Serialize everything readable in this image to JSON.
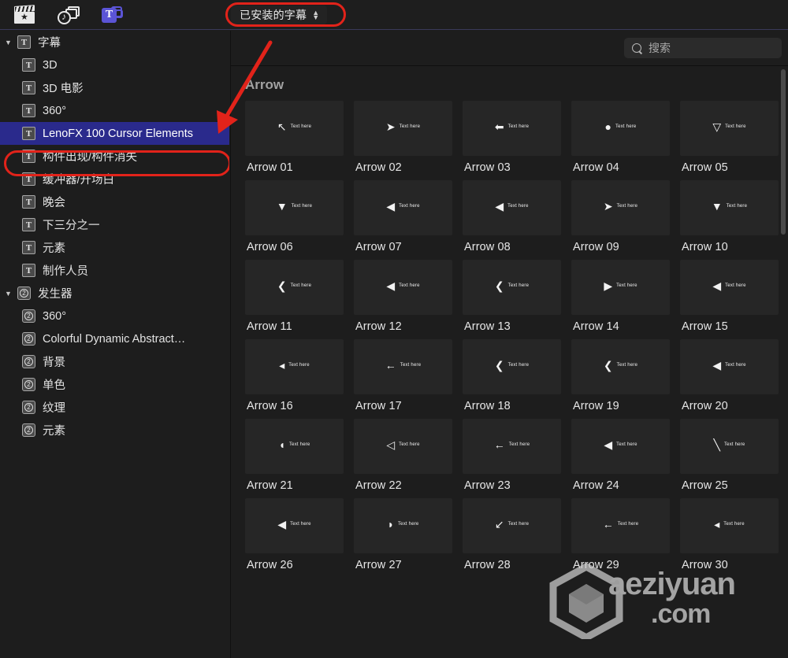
{
  "toolbar": {
    "icons": [
      {
        "name": "effects-clapperboard-icon",
        "label": "效果",
        "active": false
      },
      {
        "name": "music-photos-icon",
        "label": "音乐和照片",
        "active": false
      },
      {
        "name": "titles-generators-icon",
        "label": "T",
        "active": true
      }
    ],
    "popup": {
      "label": "已安装的字幕",
      "chevron": "⌃⌄"
    }
  },
  "annotations": {
    "oval_color": "#e2231a",
    "arrow_color": "#e2231a"
  },
  "sidebar": {
    "groups": [
      {
        "name": "titles",
        "label": "字幕",
        "icon": "title-badge-icon",
        "expanded": true,
        "twisty": "▼",
        "items": [
          {
            "label": "3D",
            "selected": false
          },
          {
            "label": "3D 电影",
            "selected": false
          },
          {
            "label": "360°",
            "selected": false
          },
          {
            "label": "LenoFX 100 Cursor Elements",
            "selected": true
          },
          {
            "label": "构件出现/构件消失",
            "selected": false
          },
          {
            "label": "缓冲器/开场白",
            "selected": false
          },
          {
            "label": "晚会",
            "selected": false
          },
          {
            "label": "下三分之一",
            "selected": false
          },
          {
            "label": "元素",
            "selected": false
          },
          {
            "label": "制作人员",
            "selected": false
          }
        ]
      },
      {
        "name": "generators",
        "label": "发生器",
        "icon": "generator-badge-icon",
        "expanded": true,
        "twisty": "▼",
        "items": [
          {
            "label": "360°",
            "selected": false
          },
          {
            "label": "Colorful Dynamic Abstract…",
            "selected": false
          },
          {
            "label": "背景",
            "selected": false
          },
          {
            "label": "单色",
            "selected": false
          },
          {
            "label": "纹理",
            "selected": false
          },
          {
            "label": "元素",
            "selected": false
          }
        ]
      }
    ],
    "selection_color": "#2a2a8c"
  },
  "main": {
    "search": {
      "placeholder": "搜索",
      "value": "",
      "icon": "search-icon"
    },
    "section_title": "Arrow",
    "thumb_caption_text": "Text here",
    "items": [
      {
        "caption": "Arrow 01",
        "glyph": "↖",
        "glyph_name": "cursor-pointer-arrow"
      },
      {
        "caption": "Arrow 02",
        "glyph": "➤",
        "glyph_name": "folded-flag-arrow"
      },
      {
        "caption": "Arrow 03",
        "glyph": "⬅",
        "glyph_name": "bold-left-arrow"
      },
      {
        "caption": "Arrow 04",
        "glyph": "●",
        "glyph_name": "dot-marker"
      },
      {
        "caption": "Arrow 05",
        "glyph": "▽",
        "glyph_name": "funnel-down-arrow"
      },
      {
        "caption": "Arrow 06",
        "glyph": "▼",
        "glyph_name": "solid-down-arrow"
      },
      {
        "caption": "Arrow 07",
        "glyph": "◀",
        "glyph_name": "dart-left-arrow"
      },
      {
        "caption": "Arrow 08",
        "glyph": "◀",
        "glyph_name": "left-triangle-arrow"
      },
      {
        "caption": "Arrow 09",
        "glyph": "➤",
        "glyph_name": "small-right-arrow"
      },
      {
        "caption": "Arrow 10",
        "glyph": "▼",
        "glyph_name": "chevron-down-arrow"
      },
      {
        "caption": "Arrow 11",
        "glyph": "❮",
        "glyph_name": "double-chevron-left"
      },
      {
        "caption": "Arrow 12",
        "glyph": "◀",
        "glyph_name": "left-play-arrow"
      },
      {
        "caption": "Arrow 13",
        "glyph": "❮",
        "glyph_name": "chevron-left-arrow"
      },
      {
        "caption": "Arrow 14",
        "glyph": "▶",
        "glyph_name": "right-triangle-arrow"
      },
      {
        "caption": "Arrow 15",
        "glyph": "◀",
        "glyph_name": "left-wedge-arrow"
      },
      {
        "caption": "Arrow 16",
        "glyph": "◂",
        "glyph_name": "small-left-triangle"
      },
      {
        "caption": "Arrow 17",
        "glyph": "←",
        "glyph_name": "thin-left-arrow"
      },
      {
        "caption": "Arrow 18",
        "glyph": "❮",
        "glyph_name": "left-double-chevron"
      },
      {
        "caption": "Arrow 19",
        "glyph": "❮",
        "glyph_name": "left-chevron"
      },
      {
        "caption": "Arrow 20",
        "glyph": "◀",
        "glyph_name": "left-crescent-arrow"
      },
      {
        "caption": "Arrow 21",
        "glyph": "◖",
        "glyph_name": "pac-circle-arrow"
      },
      {
        "caption": "Arrow 22",
        "glyph": "◁",
        "glyph_name": "outline-left-triangle"
      },
      {
        "caption": "Arrow 23",
        "glyph": "←",
        "glyph_name": "left-arrow-bar"
      },
      {
        "caption": "Arrow 24",
        "glyph": "◀",
        "glyph_name": "left-diamond-arrow"
      },
      {
        "caption": "Arrow 25",
        "glyph": "╲",
        "glyph_name": "diagonal-line-arrow"
      },
      {
        "caption": "Arrow 26",
        "glyph": "◀",
        "glyph_name": "left-arrow-block"
      },
      {
        "caption": "Arrow 27",
        "glyph": "◗",
        "glyph_name": "half-circle-arrow"
      },
      {
        "caption": "Arrow 28",
        "glyph": "↙",
        "glyph_name": "corner-bracket-arrow"
      },
      {
        "caption": "Arrow 29",
        "glyph": "←",
        "glyph_name": "left-line-arrow"
      },
      {
        "caption": "Arrow 30",
        "glyph": "◂",
        "glyph_name": "caption-arrow"
      }
    ]
  },
  "watermark": {
    "text": "aeziyuan",
    "suffix": ".com",
    "logo": "hexagon-cube-logo"
  }
}
